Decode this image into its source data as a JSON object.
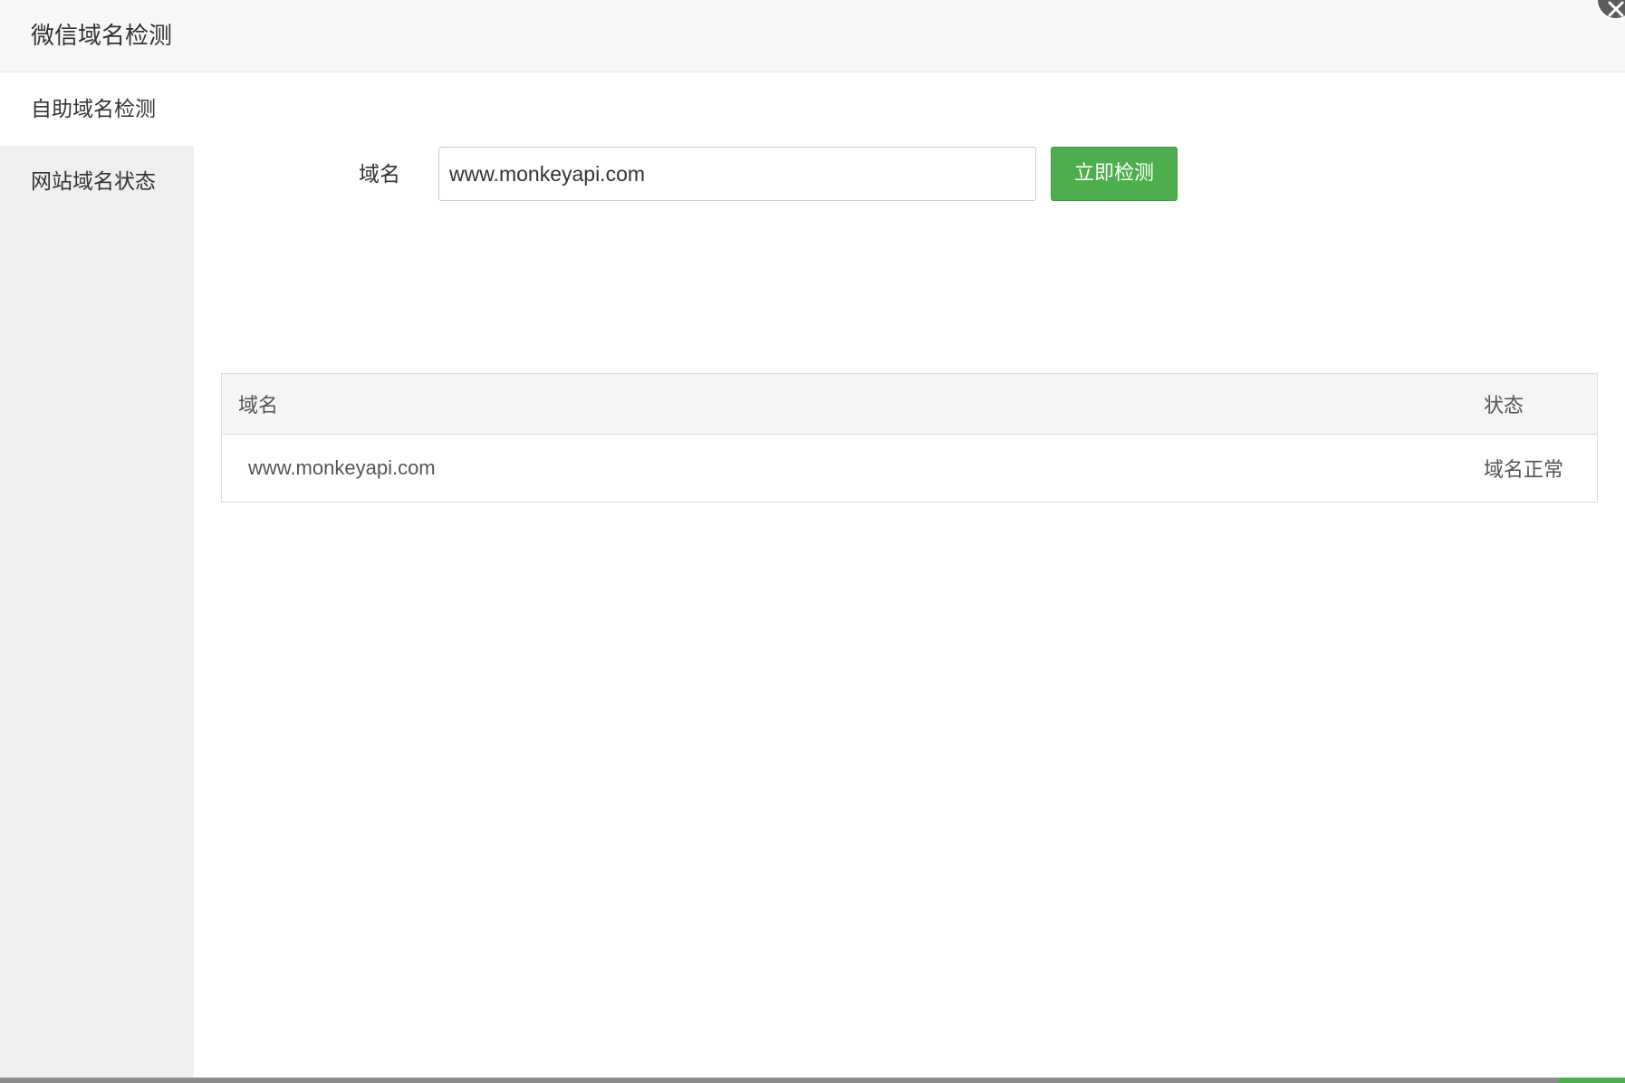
{
  "dialog": {
    "title": "微信域名检测"
  },
  "sidebar": {
    "items": [
      {
        "label": "自助域名检测",
        "active": true
      },
      {
        "label": "网站域名状态",
        "active": false
      }
    ]
  },
  "form": {
    "domain_label": "域名",
    "domain_value": "www.monkeyapi.com",
    "check_button_label": "立即检测"
  },
  "results": {
    "headers": [
      "域名",
      "状态"
    ],
    "rows": [
      {
        "domain": "www.monkeyapi.com",
        "status": "域名正常"
      }
    ]
  },
  "icons": {
    "close": "close-icon"
  },
  "colors": {
    "accent_green": "#4cae4c",
    "sidebar_bg": "#efefef",
    "title_bar_bg": "#f7f7f7"
  }
}
